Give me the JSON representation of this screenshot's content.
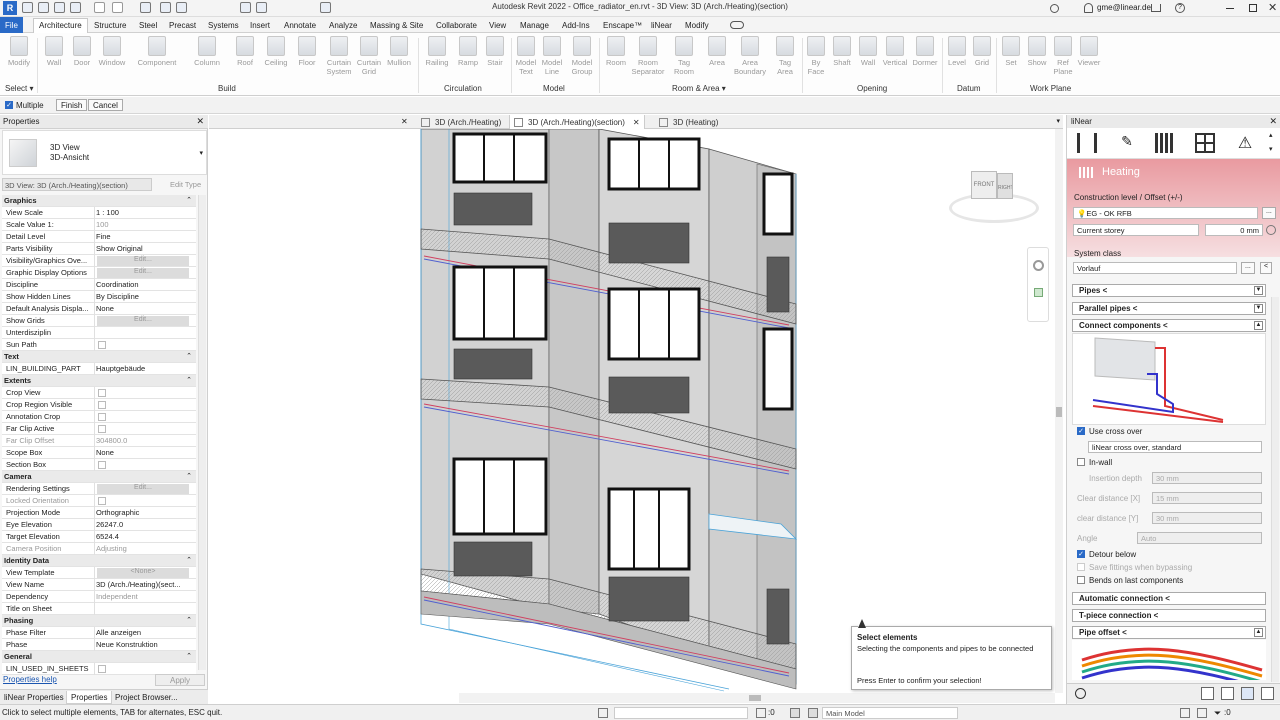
{
  "window": {
    "title": "Autodesk Revit 2022 - Office_radiator_en.rvt - 3D View: 3D (Arch./Heating)(section)",
    "user": "gme@linear.de"
  },
  "menu": [
    "File",
    "Architecture",
    "Structure",
    "Steel",
    "Precast",
    "Systems",
    "Insert",
    "Annotate",
    "Analyze",
    "Massing & Site",
    "Collaborate",
    "View",
    "Manage",
    "Add-Ins",
    "Enscape™",
    "liNear",
    "Modify"
  ],
  "ribbon": {
    "buttons": [
      "Modify",
      "Wall",
      "Door",
      "Window",
      "Component",
      "Column",
      "Roof",
      "Ceiling",
      "Floor",
      "Curtain\nSystem",
      "Curtain\nGrid",
      "Mullion",
      "Railing",
      "Ramp",
      "Stair",
      "Model\nText",
      "Model\nLine",
      "Model\nGroup",
      "Room",
      "Room\nSeparator",
      "Tag\nRoom",
      "Area",
      "Area\nBoundary",
      "Tag\nArea",
      "By\nFace",
      "Shaft",
      "Wall",
      "Vertical",
      "Dormer",
      "Level",
      "Grid",
      "Set",
      "Show",
      "Ref\nPlane",
      "Viewer"
    ],
    "panels": [
      "Select ▾",
      "Build",
      "Circulation",
      "Model",
      "Room & Area ▾",
      "Opening",
      "Datum",
      "Work Plane"
    ]
  },
  "options": {
    "multiple": "Multiple",
    "finish": "Finish",
    "cancel": "Cancel"
  },
  "properties": {
    "header": "Properties",
    "type_line1": "3D View",
    "type_line2": "3D-Ansicht",
    "selector": "3D View: 3D (Arch./Heating)(section)",
    "edit_type": "Edit Type",
    "rows": [
      {
        "k": "Graphics",
        "g": true
      },
      {
        "k": "View Scale",
        "v": "1 : 100"
      },
      {
        "k": "Scale Value    1:",
        "v": "100",
        "dim": true
      },
      {
        "k": "Detail Level",
        "v": "Fine"
      },
      {
        "k": "Parts Visibility",
        "v": "Show Original"
      },
      {
        "k": "Visibility/Graphics Ove...",
        "edit": "Edit..."
      },
      {
        "k": "Graphic Display Options",
        "edit": "Edit..."
      },
      {
        "k": "Discipline",
        "v": "Coordination"
      },
      {
        "k": "Show Hidden Lines",
        "v": "By Discipline"
      },
      {
        "k": "Default Analysis Displa...",
        "v": "None"
      },
      {
        "k": "Show Grids",
        "edit": "Edit..."
      },
      {
        "k": "Unterdisziplin",
        "v": ""
      },
      {
        "k": "Sun Path",
        "cb": true
      },
      {
        "k": "Text",
        "g": true
      },
      {
        "k": "LIN_BUILDING_PART",
        "v": "Hauptgebäude"
      },
      {
        "k": "Extents",
        "g": true
      },
      {
        "k": "Crop View",
        "cb": true
      },
      {
        "k": "Crop Region Visible",
        "cb": true
      },
      {
        "k": "Annotation Crop",
        "cb": true
      },
      {
        "k": "Far Clip Active",
        "cb": true
      },
      {
        "k": "Far Clip Offset",
        "v": "304800.0",
        "dimk": true,
        "dim": true
      },
      {
        "k": "Scope Box",
        "v": "None"
      },
      {
        "k": "Section Box",
        "cb": true
      },
      {
        "k": "Camera",
        "g": true
      },
      {
        "k": "Rendering Settings",
        "edit": "Edit..."
      },
      {
        "k": "Locked Orientation",
        "cb": true,
        "dimk": true
      },
      {
        "k": "Projection Mode",
        "v": "Orthographic"
      },
      {
        "k": "Eye Elevation",
        "v": "26247.0"
      },
      {
        "k": "Target Elevation",
        "v": "6524.4"
      },
      {
        "k": "Camera Position",
        "v": "Adjusting",
        "dimk": true,
        "dim": true
      },
      {
        "k": "Identity Data",
        "g": true
      },
      {
        "k": "View Template",
        "edit": "<None>"
      },
      {
        "k": "View Name",
        "v": "3D (Arch./Heating)(sect..."
      },
      {
        "k": "Dependency",
        "v": "Independent",
        "dim": true
      },
      {
        "k": "Title on Sheet",
        "v": ""
      },
      {
        "k": "Phasing",
        "g": true
      },
      {
        "k": "Phase Filter",
        "v": "Alle anzeigen"
      },
      {
        "k": "Phase",
        "v": "Neue Konstruktion"
      },
      {
        "k": "General",
        "g": true
      },
      {
        "k": "LIN_USED_IN_SHEETS",
        "cb": true
      }
    ],
    "help": "Properties help",
    "apply": "Apply",
    "tabs": [
      "liNear Properties",
      "Properties",
      "Project Browser..."
    ]
  },
  "view_tabs": [
    "3D (Arch./Heating)",
    "3D (Arch./Heating)(section)",
    "3D (Heating)"
  ],
  "viewcube": {
    "front": "FRONT",
    "right": "RIGHT"
  },
  "linear": {
    "header": "liNear",
    "section": "Heating",
    "construction_level_label": "Construction level / Offset (+/-)",
    "construction_level": "EG - OK RFB",
    "storey": "Current storey",
    "offset": "0 mm",
    "system_class_label": "System class",
    "system_class": "Vorlauf",
    "pipes": "Pipes <",
    "parallel_pipes": "Parallel pipes <",
    "connect_components": "Connect components <",
    "use_cross_over": "Use cross over",
    "cross_over_type": "liNear cross over, standard",
    "in_wall": "In-wall",
    "insertion_depth_label": "Insertion depth",
    "insertion_depth": "30 mm",
    "clear_x_label": "Clear distance [X]",
    "clear_x": "15 mm",
    "clear_y_label": "clear distance [Y]",
    "clear_y": "30 mm",
    "angle_label": "Angle",
    "angle": "Auto",
    "detour_below": "Detour below",
    "save_fittings": "Save fittings when bypassing",
    "bends_last": "Bends on last components",
    "automatic_connection": "Automatic connection <",
    "t_piece": "T-piece connection <",
    "pipe_offset": "Pipe offset <"
  },
  "tooltip": {
    "title": "Select elements",
    "body": "Selecting the components and pipes to be connected",
    "enter": "Press Enter to confirm your selection!"
  },
  "status": {
    "text": "Click to select multiple elements, TAB for alternates, ESC quit.",
    "count": ":0",
    "model": "Main Model"
  }
}
